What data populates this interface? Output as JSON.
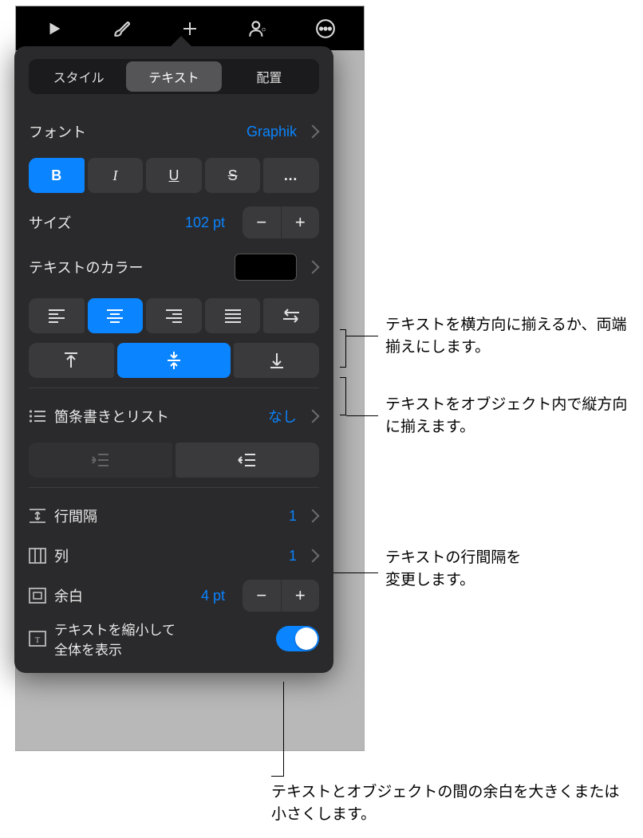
{
  "tabs": {
    "style": "スタイル",
    "text": "テキスト",
    "arrange": "配置"
  },
  "font": {
    "label": "フォント",
    "value": "Graphik"
  },
  "style_btns": {
    "bold": "B",
    "italic": "I",
    "underline": "U",
    "strike": "S",
    "more": "…"
  },
  "size": {
    "label": "サイズ",
    "value": "102 pt"
  },
  "textcolor": {
    "label": "テキストのカラー"
  },
  "bullets": {
    "label": "箇条書きとリスト",
    "value": "なし"
  },
  "linespacing": {
    "label": "行間隔",
    "value": "1"
  },
  "columns": {
    "label": "列",
    "value": "1"
  },
  "margin": {
    "label": "余白",
    "value": "4 pt"
  },
  "shrink": {
    "label1": "テキストを縮小して",
    "label2": "全体を表示"
  },
  "callouts": {
    "align_h": "テキストを横方向に揃えるか、両端揃えにします。",
    "align_v": "テキストをオブジェクト内で縦方向に揃えます。",
    "linespacing": "テキストの行間隔を\n変更します。",
    "margin": "テキストとオブジェクトの間の余白を大きくまたは小さくします。"
  }
}
